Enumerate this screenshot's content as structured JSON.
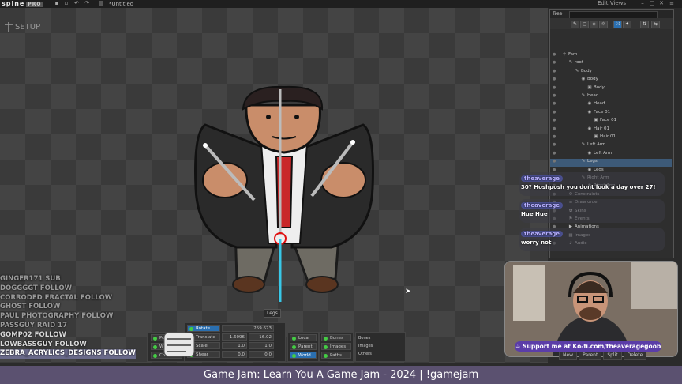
{
  "app": {
    "logo": "spine",
    "edition": "PRO",
    "filename": "*Untitled",
    "views_label": "Edit Views"
  },
  "viewport": {
    "mode_label": "SETUP",
    "selected_bone_label": "Legs"
  },
  "stream_chat": [
    {
      "text": "GINGER171 SUB",
      "style": "dim"
    },
    {
      "text": "DOGGGGT FOLLOW",
      "style": "dim"
    },
    {
      "text": "CORRODED FRACTAL FOLLOW",
      "style": "dim"
    },
    {
      "text": "GHOST FOLLOW",
      "style": "dim"
    },
    {
      "text": "PAUL PHOTOGRAPHY FOLLOW",
      "style": "dim"
    },
    {
      "text": "PASSGUY RAID 17",
      "style": "dim"
    },
    {
      "text": "GOMP02 FOLLOW",
      "style": "normal"
    },
    {
      "text": "LOWBASSGUY FOLLOW",
      "style": "normal"
    },
    {
      "text": "ZEBRA_ACRYLICS_DESIGNS FOLLOW",
      "style": "hl"
    }
  ],
  "transform_panel": {
    "tools": [
      {
        "label": "Pose"
      },
      {
        "label": "Weights"
      },
      {
        "label": "Create"
      }
    ],
    "rows": [
      {
        "label": "Rotate",
        "v1": "259.673",
        "v2": ""
      },
      {
        "label": "Translate",
        "v1": "-1.6096",
        "v2": "-16.02"
      },
      {
        "label": "Scale",
        "v1": "1.0",
        "v2": "1.0"
      },
      {
        "label": "Shear",
        "v1": "0.0",
        "v2": "0.0"
      }
    ],
    "axes": [
      {
        "label": "Local"
      },
      {
        "label": "Parent"
      },
      {
        "label": "World"
      }
    ],
    "compensate": [
      {
        "label": "Bones"
      },
      {
        "label": "Images"
      },
      {
        "label": "Paths"
      }
    ],
    "options": [
      "Bones",
      "Images",
      "Others"
    ]
  },
  "tree": {
    "title": "Tree",
    "items": [
      {
        "label": "Fam",
        "icon": "skeleton-icon",
        "indent": 0
      },
      {
        "label": "root",
        "icon": "bone-icon",
        "indent": 1
      },
      {
        "label": "Body",
        "icon": "bone-icon",
        "indent": 2
      },
      {
        "label": "Body",
        "icon": "slot-icon",
        "indent": 3
      },
      {
        "label": "Body",
        "icon": "image-icon",
        "indent": 4
      },
      {
        "label": "Head",
        "icon": "bone-icon",
        "indent": 3
      },
      {
        "label": "Head",
        "icon": "slot-icon",
        "indent": 4
      },
      {
        "label": "Face 01",
        "icon": "slot-icon",
        "indent": 4
      },
      {
        "label": "Face 01",
        "icon": "image-icon",
        "indent": 5
      },
      {
        "label": "Hair 01",
        "icon": "slot-icon",
        "indent": 4
      },
      {
        "label": "Hair 01",
        "icon": "image-icon",
        "indent": 5
      },
      {
        "label": "Left Arm",
        "icon": "bone-icon",
        "indent": 3
      },
      {
        "label": "Left Arm",
        "icon": "slot-icon",
        "indent": 4
      },
      {
        "label": "Legs",
        "icon": "bone-icon",
        "indent": 3
      },
      {
        "label": "Legs",
        "icon": "slot-icon",
        "indent": 4
      },
      {
        "label": "Right Arm",
        "icon": "bone-icon",
        "indent": 3
      },
      {
        "label": "Right Arm",
        "icon": "slot-icon",
        "indent": 4
      },
      {
        "label": "Constraints",
        "icon": "constraint-icon",
        "indent": 1
      },
      {
        "label": "Draw order",
        "icon": "draworder-icon",
        "indent": 1
      },
      {
        "label": "Skins",
        "icon": "skins-icon",
        "indent": 1
      },
      {
        "label": "Events",
        "icon": "events-icon",
        "indent": 1
      },
      {
        "label": "Animations",
        "icon": "animations-icon",
        "indent": 1
      },
      {
        "label": "Images",
        "icon": "images-icon",
        "indent": 1
      },
      {
        "label": "Audio",
        "icon": "audio-icon",
        "indent": 1
      }
    ],
    "bottom_buttons": [
      "New",
      "Parent",
      "Split",
      "Delete"
    ]
  },
  "overlay_messages": [
    {
      "user": "theaverage",
      "text": "30? Hoshposh you dont look a day over 27!"
    },
    {
      "user": "theaverage",
      "text": "Hue Hue"
    },
    {
      "user": "theaverage",
      "text": "worry not"
    }
  ],
  "kofi_banner": "Support me at Ko-fi.com/theaveragegoob",
  "stream_title": "Game Jam: Learn You A Game Jam - 2024 | !gamejam",
  "colors": {
    "accent": "#2a6fb0",
    "banner": "#5b5170",
    "kofi": "#5b3da8",
    "selected_row": "#3d5a78"
  }
}
